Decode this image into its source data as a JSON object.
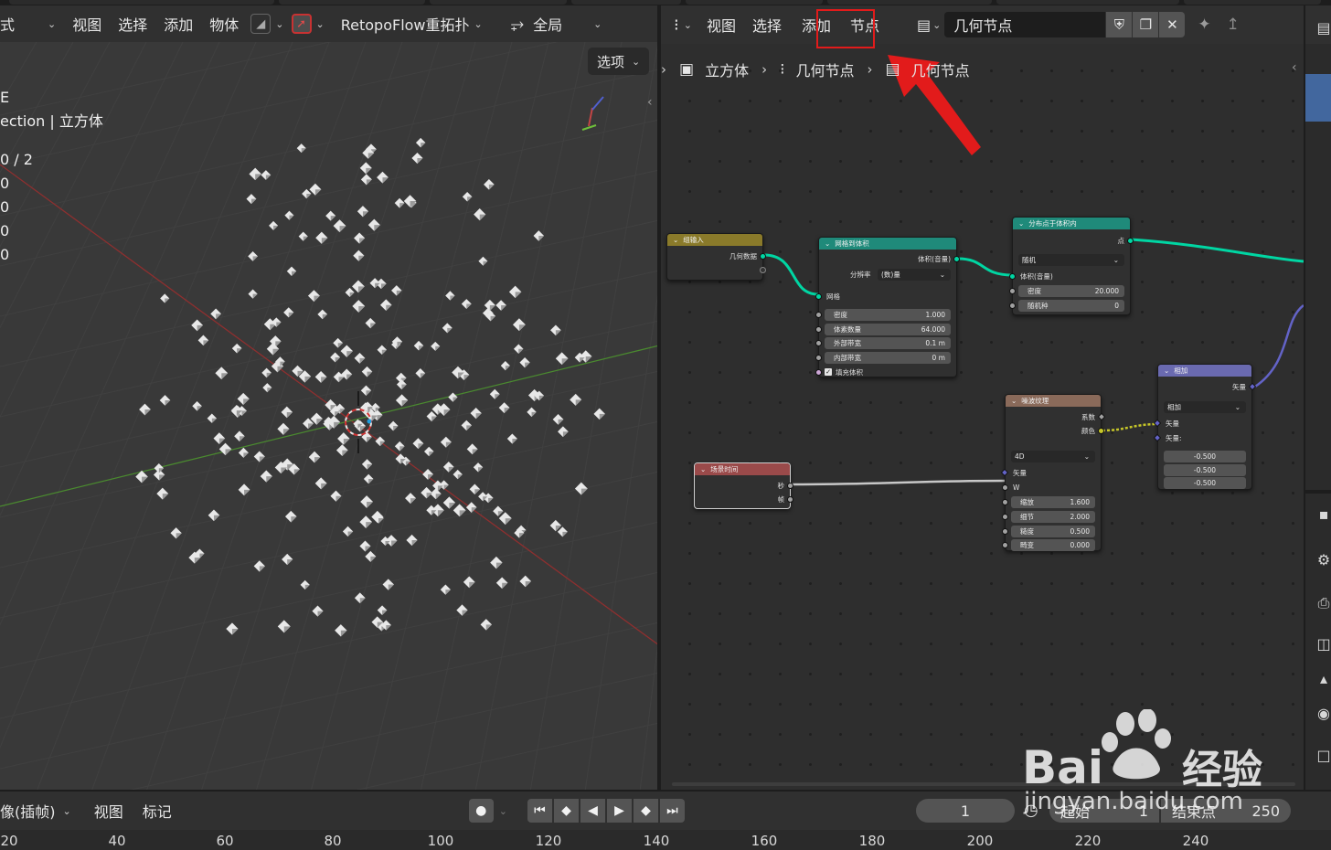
{
  "viewport": {
    "header": {
      "mode_label": "式",
      "menu_view": "视图",
      "menu_select": "选择",
      "menu_add": "添加",
      "menu_object": "物体",
      "retopoflow": "RetopoFlow重拓扑",
      "transform_orientation": "全局",
      "options_label": "选项"
    },
    "stats": {
      "line1": "E",
      "line2": "ection | 立方体",
      "line3": "0 / 2",
      "line4": "0",
      "line5": "0",
      "line6": "0",
      "line7": "0"
    },
    "colors": {
      "background": "#393939",
      "x_axis": "#8e2f2f",
      "y_axis": "#4a8a2f"
    }
  },
  "node_editor": {
    "header": {
      "menu_view": "视图",
      "menu_select": "选择",
      "menu_add": "添加",
      "menu_node": "节点",
      "tree_name": "几何节点"
    },
    "breadcrumb": [
      "立方体",
      "几何节点",
      "几何节点"
    ],
    "highlight_color": "#e21b1b",
    "nodes": {
      "group_input": {
        "title": "组输入",
        "output_geometry": "几何数据",
        "header_color": "#8a7a2a"
      },
      "mesh_to_volume": {
        "title": "网格到体积",
        "output_volume": "体积(音量)",
        "resolution_label": "分辨率",
        "resolution_value": "(数)量",
        "input_mesh": "网格",
        "fields": [
          {
            "label": "密度",
            "value": "1.000"
          },
          {
            "label": "体素数量",
            "value": "64.000"
          },
          {
            "label": "外部带宽",
            "value": "0.1 m"
          },
          {
            "label": "内部带宽",
            "value": "0 m"
          }
        ],
        "fill_volume": "填充体积",
        "header_color": "#1f8a7a"
      },
      "distribute_points": {
        "title": "分布点于体积内",
        "output_points": "点",
        "mode_value": "随机",
        "input_volume": "体积(音量)",
        "fields": [
          {
            "label": "密度",
            "value": "20.000"
          },
          {
            "label": "随机种",
            "value": "0"
          }
        ],
        "header_color": "#1f8a7a"
      },
      "vector_math": {
        "title": "相加",
        "output_vector": "矢量",
        "operation": "相加",
        "input_vector_a": "矢量",
        "input_vector_b": "矢量:",
        "values": [
          "-0.500",
          "-0.500",
          "-0.500"
        ],
        "header_color": "#6a6ab0"
      },
      "noise_texture": {
        "title": "噪波纹理",
        "output_fac": "系数",
        "output_color": "颜色",
        "dimension": "4D",
        "input_vector": "矢量",
        "input_w": "W",
        "fields": [
          {
            "label": "缩放",
            "value": "1.600"
          },
          {
            "label": "细节",
            "value": "2.000"
          },
          {
            "label": "糙度",
            "value": "0.500"
          },
          {
            "label": "畸变",
            "value": "0.000"
          }
        ],
        "header_color": "#8a6a5a"
      },
      "scene_time": {
        "title": "场景时间",
        "output_seconds": "秒",
        "output_frame": "帧",
        "header_color": "#9a4a4a"
      }
    },
    "wire_colors": {
      "geometry": "#00d6a3",
      "float": "#a1a1a1",
      "vector": "#6363c7",
      "color": "#c7c729"
    }
  },
  "timeline": {
    "header": {
      "keying_label": "像(插帧)",
      "menu_view": "视图",
      "menu_marker": "标记",
      "current_frame": "1",
      "start_label": "起始",
      "start_value": "1",
      "end_label": "结束点",
      "end_value": "250"
    },
    "ruler": [
      "20",
      "40",
      "60",
      "80",
      "100",
      "120",
      "140",
      "160",
      "180",
      "200",
      "220",
      "240"
    ]
  },
  "icons": {
    "viewport": [
      "overlay-icon",
      "snap-icon",
      "proportional-icon",
      "transform-icon"
    ],
    "node_editor": [
      "geometry-nodes-icon",
      "node-tree-icon",
      "fake-user-shield-icon",
      "duplicate-icon",
      "close-icon",
      "pin-icon",
      "parent-up-icon"
    ],
    "properties": [
      "tool-icon",
      "render-icon",
      "output-icon",
      "view-layer-icon",
      "scene-icon",
      "world-icon",
      "collection-icon"
    ]
  },
  "watermark": {
    "line1": "Bai",
    "line1b": "经验",
    "line2": "jingyan.baidu.com"
  }
}
